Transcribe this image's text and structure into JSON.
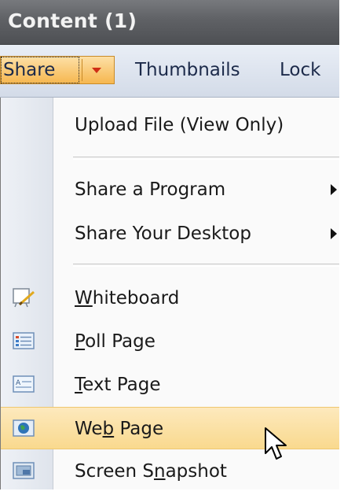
{
  "window": {
    "title": "Content (1)"
  },
  "toolbar": {
    "share_label": "Share",
    "thumbnails_label": "Thumbnails",
    "lock_label": "Lock"
  },
  "menu": {
    "upload": "Upload File (View Only)",
    "share_program": "Share a Program",
    "share_desktop": "Share Your Desktop",
    "whiteboard": {
      "pre": "",
      "key": "W",
      "post": "hiteboard"
    },
    "poll_page": {
      "pre": "",
      "key": "P",
      "post": "oll Page"
    },
    "text_page": {
      "pre": "",
      "key": "T",
      "post": "ext Page"
    },
    "web_page": {
      "pre": "We",
      "key": "b",
      "post": " Page"
    },
    "screen_snapshot": {
      "pre": "Screen S",
      "key": "n",
      "post": "apshot"
    }
  },
  "icons": {
    "whiteboard": "whiteboard-icon",
    "poll": "poll-page-icon",
    "text": "text-page-icon",
    "web": "globe-icon",
    "snapshot": "screen-snapshot-icon"
  },
  "colors": {
    "title_bar": "#5f6165",
    "share_highlight": "#f6b74f",
    "hover_highlight": "#f9d98e",
    "dropdown_arrow": "#cf2e16"
  }
}
